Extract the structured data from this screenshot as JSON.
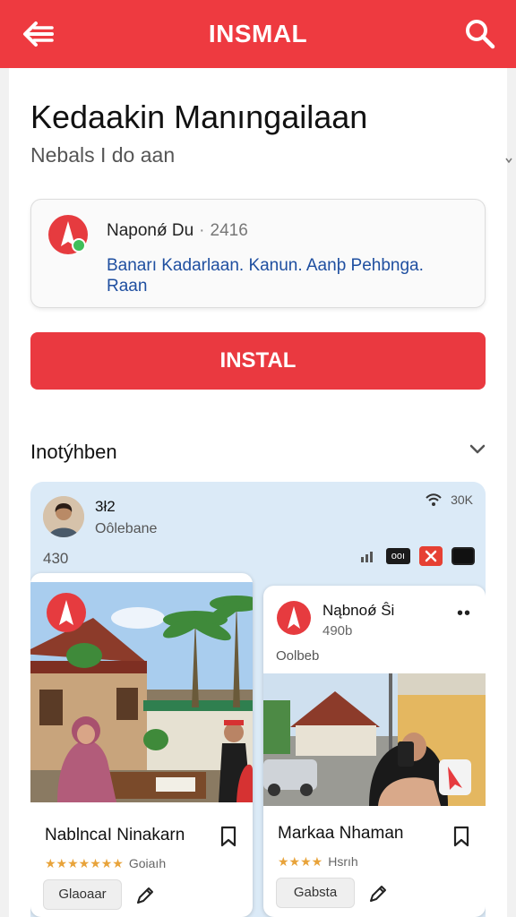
{
  "header": {
    "title": "INSMAL",
    "back_icon": "back-arrow-icon",
    "search_icon": "search-icon",
    "color": "#ee3a40"
  },
  "main": {
    "heading": "Kedaakin Manıngailaan",
    "subheading": "Nebals I do aan"
  },
  "app": {
    "name": "Naponǿ Du",
    "separator": "·",
    "version": "2416",
    "description": "Banarı Kadarlaan. Kanun. Aanþ Pehbnga. Raan"
  },
  "install_button": {
    "label": "INSTAL",
    "color": "#ea3940"
  },
  "section": {
    "title": "Inotýhben"
  },
  "gallery": {
    "profile_name": "3ł2",
    "profile_sub": "Oôlebane",
    "time": "30K",
    "count": "430",
    "status_pill": "ooı"
  },
  "cards": [
    {
      "title": "NablncaI Ninakarn",
      "rating": 4.5,
      "stars": "★★★★★★★",
      "rating_label": "Goiaıh",
      "tag": "Glaoaar"
    },
    {
      "app_name": "Nąbnoǿ Ŝi",
      "version": "490b",
      "more": "••",
      "subtitle": "Oolbeb",
      "title": "Markaa Nhaman",
      "rating": 4,
      "stars": "★★★★",
      "rating_label": "Hsrıh",
      "tag": "Gabsta"
    }
  ]
}
